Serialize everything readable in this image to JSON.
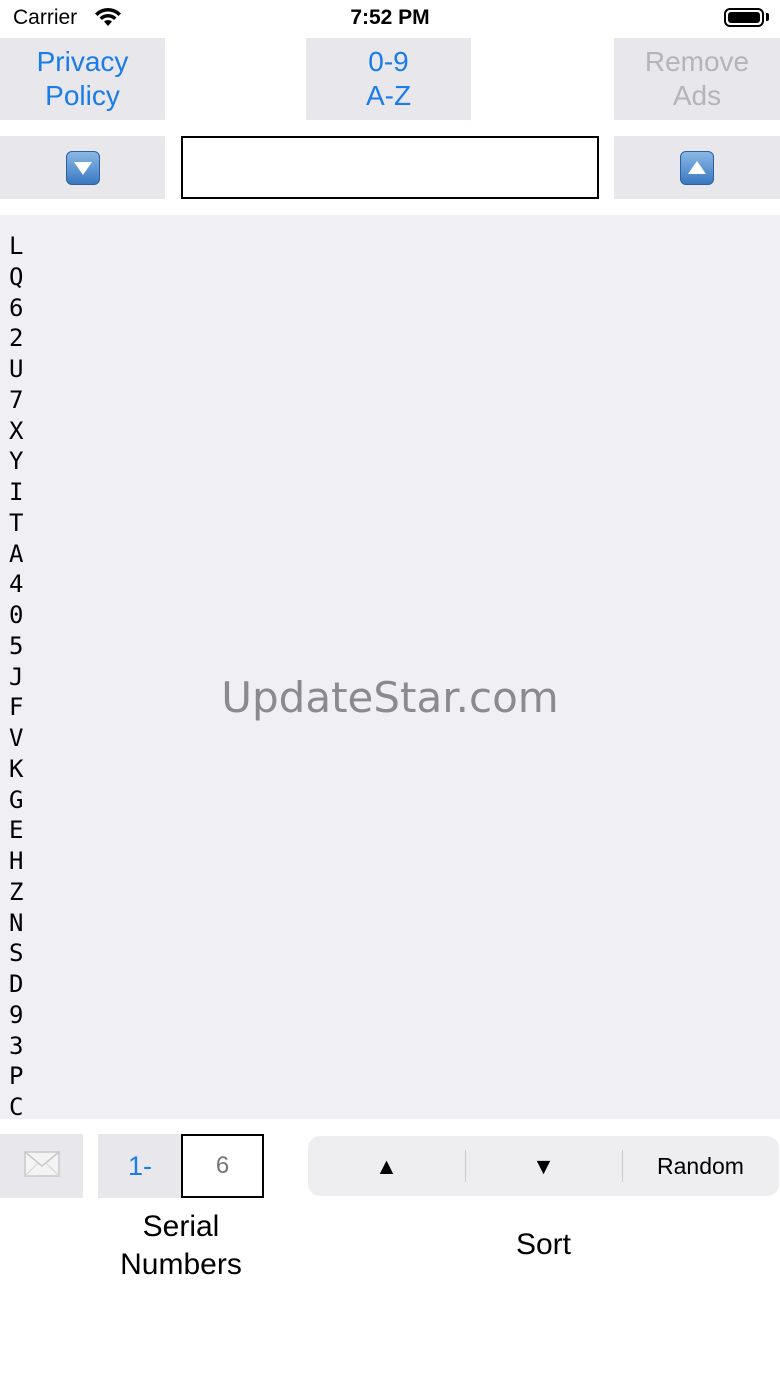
{
  "status_bar": {
    "carrier": "Carrier",
    "time": "7:52 PM"
  },
  "header": {
    "privacy_label": "Privacy\nPolicy",
    "az_label": "0-9\nA-Z",
    "remove_ads_label": "Remove\nAds"
  },
  "search": {
    "value": ""
  },
  "list": {
    "items": [
      "L",
      "Q",
      "6",
      "2",
      "U",
      "7",
      "X",
      "Y",
      "I",
      "T",
      "A",
      "4",
      "0",
      "5",
      "J",
      "F",
      "V",
      "K",
      "G",
      "E",
      "H",
      "Z",
      "N",
      "S",
      "D",
      "9",
      "3",
      "P",
      "C"
    ],
    "watermark": "UpdateStar.com"
  },
  "bottom": {
    "serial_button": "1-",
    "serial_placeholder": "6",
    "serial_label": "Serial\nNumbers",
    "sort_options": [
      "▲",
      "▼",
      "Random"
    ],
    "sort_label": "Sort"
  },
  "icons": {
    "mail": "envelope-icon",
    "down": "down-arrow-icon",
    "up": "up-arrow-icon"
  },
  "colors": {
    "accent": "#1a7bea",
    "disabled": "#b5b5b9",
    "list_bg": "#efeff4",
    "button_bg": "#e8e8ec"
  }
}
